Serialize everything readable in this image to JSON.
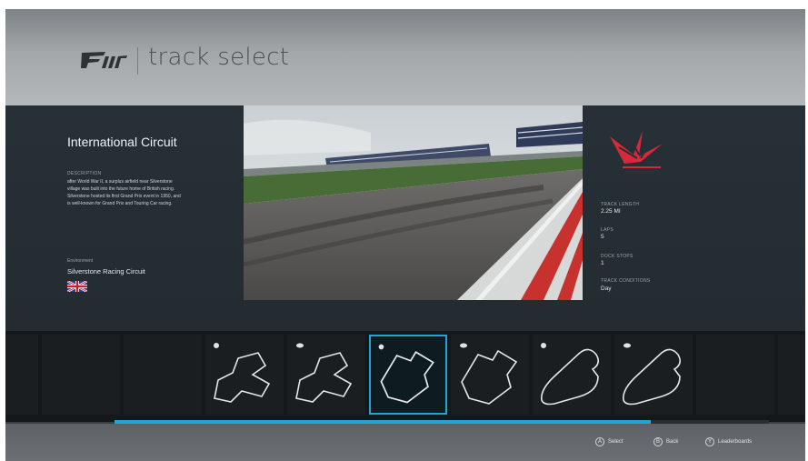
{
  "header": {
    "screen_title": "track select",
    "logo_icon": "forza-logo-icon"
  },
  "track": {
    "name": "International Circuit",
    "description_label": "DESCRIPTION",
    "description": "after World War II, a surplus airfield near Silverstone village was built into the future home of British racing. Silverstone hosted its first Grand Prix event in 1950, and is well-known for Grand Prix and Touring Car racing.",
    "environment_label": "Environment",
    "environment": "Silverstone Racing Circuit",
    "flag_icon": "uk-flag-icon",
    "brand_icon": "silverstone-logo-icon"
  },
  "stats": [
    {
      "label": "TRACK LENGTH",
      "value": "2.25 MI"
    },
    {
      "label": "LAPS",
      "value": "5"
    },
    {
      "label": "DOCK STOPS",
      "value": "1"
    },
    {
      "label": "TRACK CONDITIONS",
      "value": "Day"
    }
  ],
  "carousel": {
    "selected_index": 4,
    "scroll_progress": 0.82,
    "accent_color": "#1ea6d2"
  },
  "footer": {
    "hints": [
      {
        "button": "A",
        "label": "Select"
      },
      {
        "button": "B",
        "label": "Back"
      },
      {
        "button": "Y",
        "label": "Leaderboards"
      }
    ]
  }
}
